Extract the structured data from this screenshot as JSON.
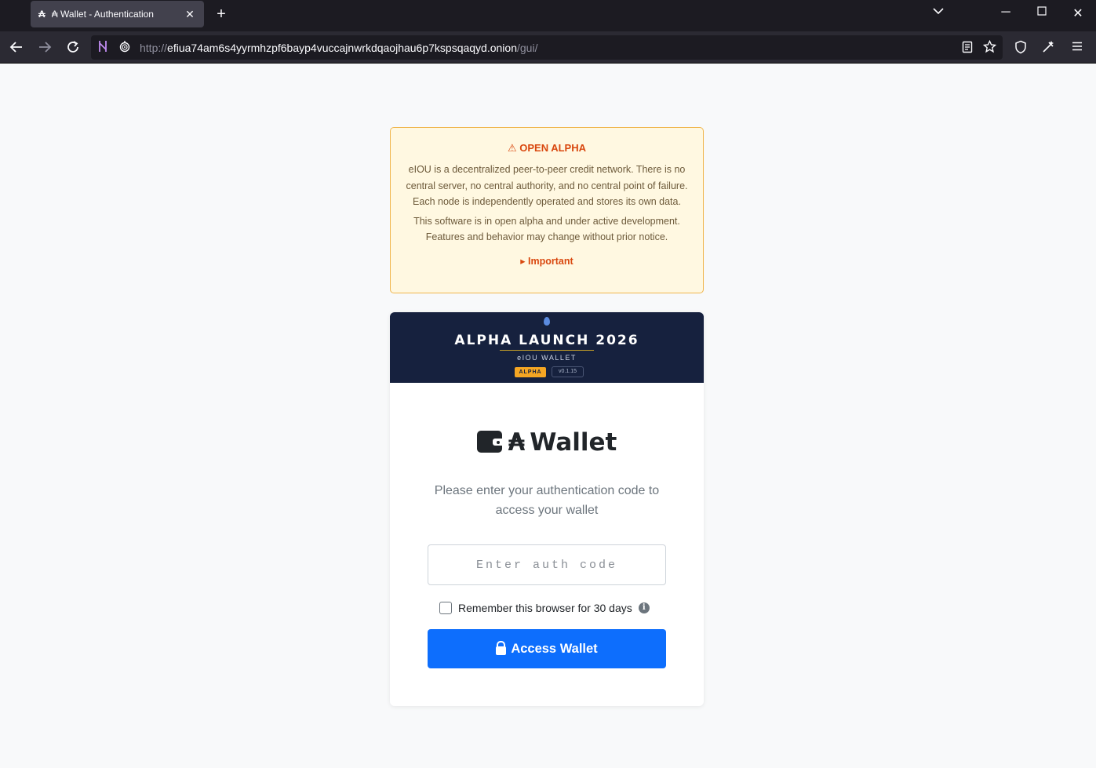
{
  "browser": {
    "tab_title": "₳ Wallet - Authentication",
    "tab_favicon": "₳",
    "url_scheme": "http://",
    "url_host": "efiua74am6s4yyrmhzpf6bayp4vuccajnwrkdqaojhau6p7kspsqaqyd.onion",
    "url_path": "/gui/"
  },
  "notice": {
    "title": "⚠ OPEN ALPHA",
    "paragraph1": "eIOU is a decentralized peer-to-peer credit network. There is no central server, no central authority, and no central point of failure. Each node is independently operated and stores its own data.",
    "paragraph2": "This software is in open alpha and under active development. Features and behavior may change without prior notice.",
    "details_label": "▸ Important",
    "border_color": "#f0b64d",
    "accent_color": "#d9480f"
  },
  "banner": {
    "headline": "ALPHA LAUNCH 2026",
    "subtitle": "eIOU WALLET",
    "badge": "ALPHA",
    "version": "v0.1.15",
    "background": "#16213e"
  },
  "login": {
    "currency_symbol": "₳",
    "title": "Wallet",
    "prompt": "Please enter your authentication code to access your wallet",
    "auth_placeholder": "Enter auth code",
    "remember_label": "Remember this browser for 30 days",
    "remember_checked": false,
    "submit_label": "Access Wallet",
    "primary_color": "#0d6efd"
  }
}
